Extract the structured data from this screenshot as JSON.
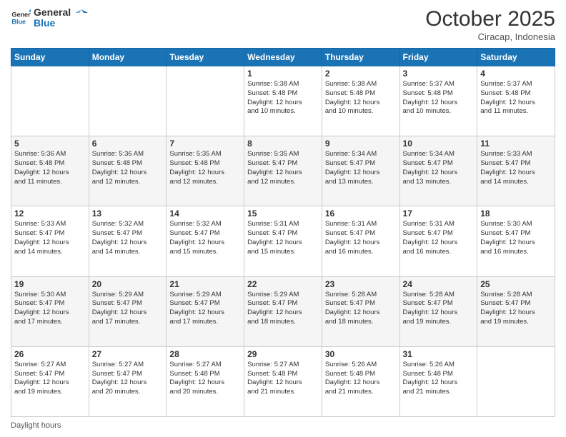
{
  "header": {
    "logo_line1": "General",
    "logo_line2": "Blue",
    "month": "October 2025",
    "location": "Ciracap, Indonesia"
  },
  "days_of_week": [
    "Sunday",
    "Monday",
    "Tuesday",
    "Wednesday",
    "Thursday",
    "Friday",
    "Saturday"
  ],
  "weeks": [
    [
      {
        "day": "",
        "info": ""
      },
      {
        "day": "",
        "info": ""
      },
      {
        "day": "",
        "info": ""
      },
      {
        "day": "1",
        "info": "Sunrise: 5:38 AM\nSunset: 5:48 PM\nDaylight: 12 hours\nand 10 minutes."
      },
      {
        "day": "2",
        "info": "Sunrise: 5:38 AM\nSunset: 5:48 PM\nDaylight: 12 hours\nand 10 minutes."
      },
      {
        "day": "3",
        "info": "Sunrise: 5:37 AM\nSunset: 5:48 PM\nDaylight: 12 hours\nand 10 minutes."
      },
      {
        "day": "4",
        "info": "Sunrise: 5:37 AM\nSunset: 5:48 PM\nDaylight: 12 hours\nand 11 minutes."
      }
    ],
    [
      {
        "day": "5",
        "info": "Sunrise: 5:36 AM\nSunset: 5:48 PM\nDaylight: 12 hours\nand 11 minutes."
      },
      {
        "day": "6",
        "info": "Sunrise: 5:36 AM\nSunset: 5:48 PM\nDaylight: 12 hours\nand 12 minutes."
      },
      {
        "day": "7",
        "info": "Sunrise: 5:35 AM\nSunset: 5:48 PM\nDaylight: 12 hours\nand 12 minutes."
      },
      {
        "day": "8",
        "info": "Sunrise: 5:35 AM\nSunset: 5:47 PM\nDaylight: 12 hours\nand 12 minutes."
      },
      {
        "day": "9",
        "info": "Sunrise: 5:34 AM\nSunset: 5:47 PM\nDaylight: 12 hours\nand 13 minutes."
      },
      {
        "day": "10",
        "info": "Sunrise: 5:34 AM\nSunset: 5:47 PM\nDaylight: 12 hours\nand 13 minutes."
      },
      {
        "day": "11",
        "info": "Sunrise: 5:33 AM\nSunset: 5:47 PM\nDaylight: 12 hours\nand 14 minutes."
      }
    ],
    [
      {
        "day": "12",
        "info": "Sunrise: 5:33 AM\nSunset: 5:47 PM\nDaylight: 12 hours\nand 14 minutes."
      },
      {
        "day": "13",
        "info": "Sunrise: 5:32 AM\nSunset: 5:47 PM\nDaylight: 12 hours\nand 14 minutes."
      },
      {
        "day": "14",
        "info": "Sunrise: 5:32 AM\nSunset: 5:47 PM\nDaylight: 12 hours\nand 15 minutes."
      },
      {
        "day": "15",
        "info": "Sunrise: 5:31 AM\nSunset: 5:47 PM\nDaylight: 12 hours\nand 15 minutes."
      },
      {
        "day": "16",
        "info": "Sunrise: 5:31 AM\nSunset: 5:47 PM\nDaylight: 12 hours\nand 16 minutes."
      },
      {
        "day": "17",
        "info": "Sunrise: 5:31 AM\nSunset: 5:47 PM\nDaylight: 12 hours\nand 16 minutes."
      },
      {
        "day": "18",
        "info": "Sunrise: 5:30 AM\nSunset: 5:47 PM\nDaylight: 12 hours\nand 16 minutes."
      }
    ],
    [
      {
        "day": "19",
        "info": "Sunrise: 5:30 AM\nSunset: 5:47 PM\nDaylight: 12 hours\nand 17 minutes."
      },
      {
        "day": "20",
        "info": "Sunrise: 5:29 AM\nSunset: 5:47 PM\nDaylight: 12 hours\nand 17 minutes."
      },
      {
        "day": "21",
        "info": "Sunrise: 5:29 AM\nSunset: 5:47 PM\nDaylight: 12 hours\nand 17 minutes."
      },
      {
        "day": "22",
        "info": "Sunrise: 5:29 AM\nSunset: 5:47 PM\nDaylight: 12 hours\nand 18 minutes."
      },
      {
        "day": "23",
        "info": "Sunrise: 5:28 AM\nSunset: 5:47 PM\nDaylight: 12 hours\nand 18 minutes."
      },
      {
        "day": "24",
        "info": "Sunrise: 5:28 AM\nSunset: 5:47 PM\nDaylight: 12 hours\nand 19 minutes."
      },
      {
        "day": "25",
        "info": "Sunrise: 5:28 AM\nSunset: 5:47 PM\nDaylight: 12 hours\nand 19 minutes."
      }
    ],
    [
      {
        "day": "26",
        "info": "Sunrise: 5:27 AM\nSunset: 5:47 PM\nDaylight: 12 hours\nand 19 minutes."
      },
      {
        "day": "27",
        "info": "Sunrise: 5:27 AM\nSunset: 5:47 PM\nDaylight: 12 hours\nand 20 minutes."
      },
      {
        "day": "28",
        "info": "Sunrise: 5:27 AM\nSunset: 5:48 PM\nDaylight: 12 hours\nand 20 minutes."
      },
      {
        "day": "29",
        "info": "Sunrise: 5:27 AM\nSunset: 5:48 PM\nDaylight: 12 hours\nand 21 minutes."
      },
      {
        "day": "30",
        "info": "Sunrise: 5:26 AM\nSunset: 5:48 PM\nDaylight: 12 hours\nand 21 minutes."
      },
      {
        "day": "31",
        "info": "Sunrise: 5:26 AM\nSunset: 5:48 PM\nDaylight: 12 hours\nand 21 minutes."
      },
      {
        "day": "",
        "info": ""
      }
    ]
  ],
  "footer": {
    "daylight_label": "Daylight hours"
  }
}
